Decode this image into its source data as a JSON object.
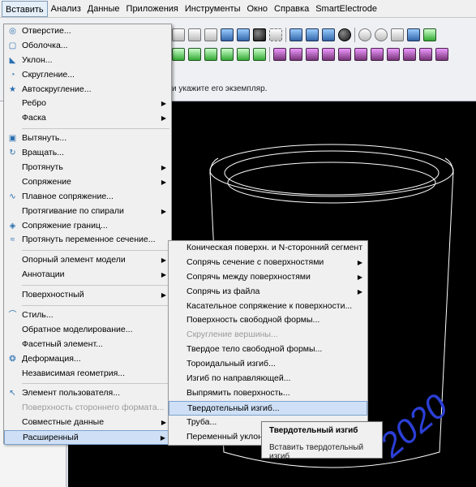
{
  "menubar": {
    "items": [
      "Вставить",
      "Анализ",
      "Данные",
      "Приложения",
      "Инструменты",
      "Окно",
      "Справка",
      "SmartElectrode"
    ]
  },
  "hint_text": "и укажите его экземпляр.",
  "main_menu": {
    "items": [
      {
        "label": "Отверстие...",
        "icon": "hole-icon"
      },
      {
        "label": "Оболочка...",
        "icon": "shell-icon"
      },
      {
        "label": "Уклон...",
        "icon": "draft-icon"
      },
      {
        "label": "Скругление...",
        "icon": "round-icon"
      },
      {
        "label": "Автоскругление...",
        "icon": "auto-round-icon"
      },
      {
        "label": "Ребро",
        "submenu": true
      },
      {
        "label": "Фаска",
        "submenu": true
      },
      {
        "separator": true
      },
      {
        "label": "Вытянуть...",
        "icon": "extrude-icon"
      },
      {
        "label": "Вращать...",
        "icon": "revolve-icon"
      },
      {
        "label": "Протянуть",
        "submenu": true
      },
      {
        "label": "Сопряжение",
        "submenu": true
      },
      {
        "label": "Плавное сопряжение...",
        "icon": "swept-blend-icon"
      },
      {
        "label": "Протягивание по спирали",
        "submenu": true
      },
      {
        "label": "Сопряжение границ...",
        "icon": "boundary-blend-icon"
      },
      {
        "label": "Протянуть переменное сечение...",
        "icon": "variable-sweep-icon"
      },
      {
        "separator": true
      },
      {
        "label": "Опорный элемент модели",
        "submenu": true
      },
      {
        "label": "Аннотации",
        "submenu": true
      },
      {
        "separator": true
      },
      {
        "label": "Поверхностный",
        "submenu": true
      },
      {
        "separator": true
      },
      {
        "label": "Стиль...",
        "icon": "style-icon"
      },
      {
        "label": "Обратное моделирование...",
        "icon": ""
      },
      {
        "label": "Фасетный элемент...",
        "icon": ""
      },
      {
        "label": "Деформация...",
        "icon": "warp-icon"
      },
      {
        "label": "Независимая геометрия...",
        "icon": ""
      },
      {
        "separator": true
      },
      {
        "label": "Элемент пользователя...",
        "icon": "udf-icon"
      },
      {
        "label": "Поверхность стороннего формата...",
        "disabled": true
      },
      {
        "label": "Совместные данные",
        "submenu": true
      },
      {
        "label": "Расширенный",
        "submenu": true,
        "highlighted": true
      }
    ]
  },
  "sub_menu": {
    "items": [
      {
        "label": "Коническая поверхн. и N-сторонний сегмент"
      },
      {
        "label": "Сопрячь сечение с поверхностями",
        "submenu": true
      },
      {
        "label": "Сопрячь между поверхностями",
        "submenu": true
      },
      {
        "label": "Сопрячь из файла",
        "submenu": true
      },
      {
        "label": "Касательное сопряжение к поверхности..."
      },
      {
        "label": "Поверхность свободной формы..."
      },
      {
        "label": "Скругление вершины...",
        "disabled": true
      },
      {
        "label": "Твердое тело свободной формы..."
      },
      {
        "label": "Тороидальный изгиб..."
      },
      {
        "label": "Изгиб по направляющей..."
      },
      {
        "label": "Выпрямить поверхность..."
      },
      {
        "label": "Твердотельный изгиб...",
        "highlighted": true
      },
      {
        "label": "Труба..."
      },
      {
        "label": "Переменный уклон..."
      }
    ]
  },
  "tooltip": {
    "title": "Твердотельный изгиб",
    "description": "Вставить твердотельный изгиб"
  },
  "viewport": {
    "model_text": "2020",
    "background": "#000000",
    "edge_color": "#ffffff",
    "text_color": "#2b3fd6"
  }
}
